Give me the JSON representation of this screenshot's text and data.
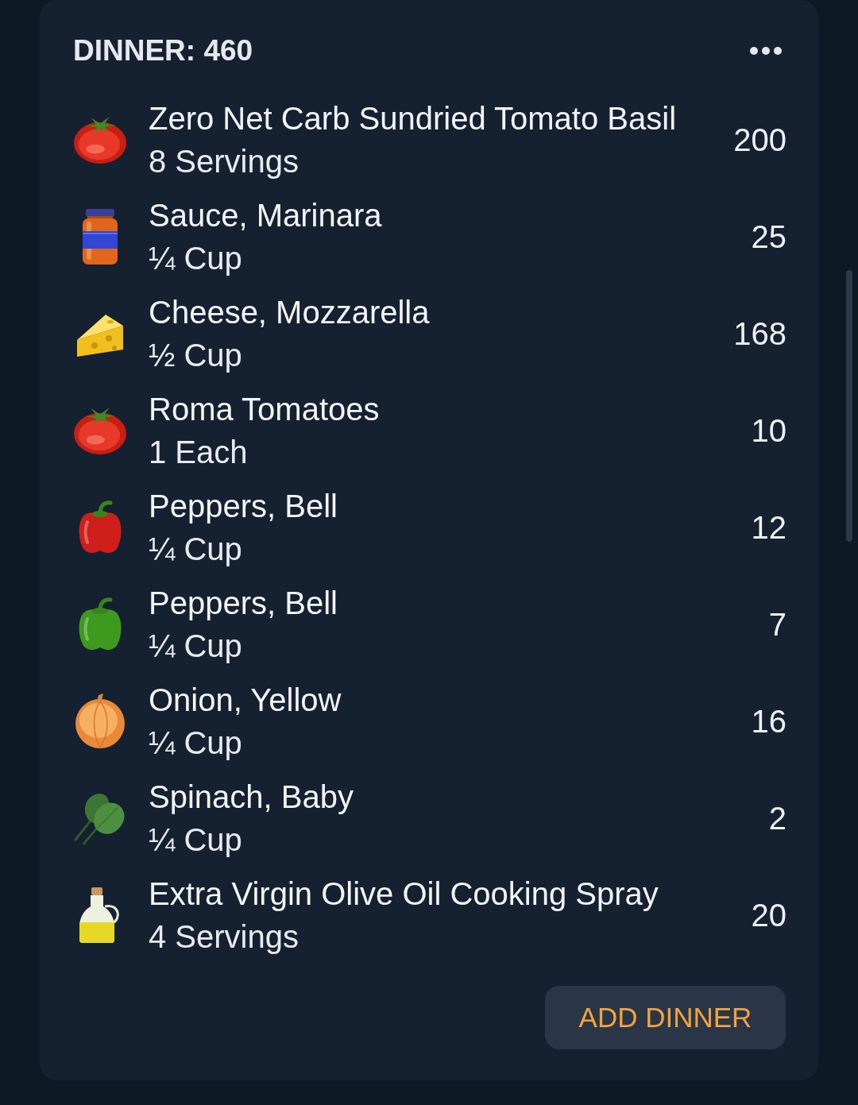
{
  "header": {
    "title": "DINNER: 460"
  },
  "items": [
    {
      "kind": "tomato",
      "name": "Zero Net Carb Sundried Tomato Basil",
      "serving": "8 Servings",
      "calories": "200"
    },
    {
      "kind": "jar",
      "name": "Sauce, Marinara",
      "serving": "¼ Cup",
      "calories": "25"
    },
    {
      "kind": "cheese",
      "name": "Cheese, Mozzarella",
      "serving": "½ Cup",
      "calories": "168"
    },
    {
      "kind": "tomato",
      "name": "Roma Tomatoes",
      "serving": "1 Each",
      "calories": "10"
    },
    {
      "kind": "pepper",
      "color": "#d01f1a",
      "name": "Peppers, Bell",
      "serving": "¼ Cup",
      "calories": "12"
    },
    {
      "kind": "pepper",
      "color": "#3e9a1e",
      "name": "Peppers, Bell",
      "serving": "¼ Cup",
      "calories": "7"
    },
    {
      "kind": "onion",
      "name": "Onion, Yellow",
      "serving": "¼ Cup",
      "calories": "16"
    },
    {
      "kind": "spinach",
      "name": "Spinach, Baby",
      "serving": "¼ Cup",
      "calories": "2"
    },
    {
      "kind": "bottle",
      "name": "Extra Virgin Olive Oil Cooking Spray",
      "serving": "4 Servings",
      "calories": "20"
    }
  ],
  "button": {
    "label": "ADD DINNER"
  }
}
